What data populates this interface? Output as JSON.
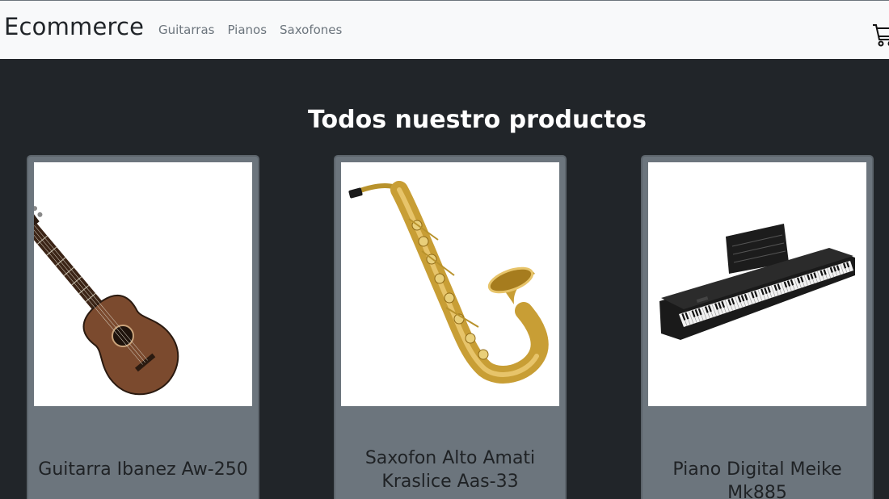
{
  "navbar": {
    "brand": "Ecommerce",
    "links": [
      "Guitarras",
      "Pianos",
      "Saxofones"
    ],
    "cart_icon": "cart-icon"
  },
  "main": {
    "heading": "Todos nuestro productos",
    "products": [
      {
        "title": "Guitarra Ibanez Aw-250",
        "image": "acoustic-guitar"
      },
      {
        "title": "Saxofon Alto Amati Kraslice Aas-33",
        "image": "alto-saxophone"
      },
      {
        "title": "Piano Digital Meike Mk885",
        "image": "digital-piano"
      }
    ]
  },
  "colors": {
    "navbar_bg": "#f8f9fa",
    "page_bg": "#212529",
    "card_bg": "#6c757d"
  }
}
